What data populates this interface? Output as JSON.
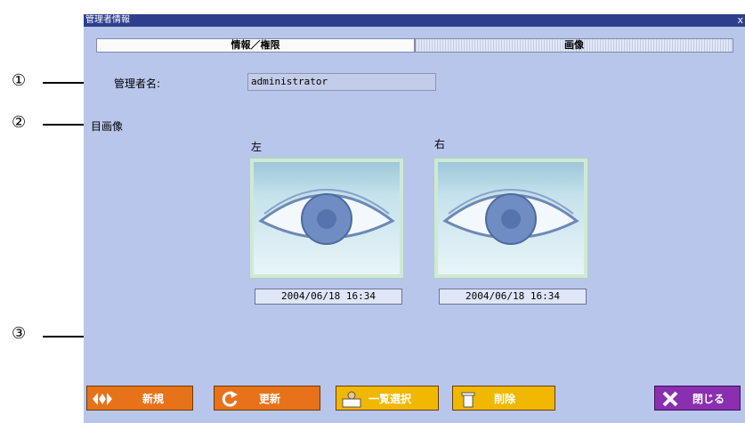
{
  "window": {
    "title": "管理者情報",
    "close_glyph": "x"
  },
  "tabs": [
    {
      "label": "情報／権限"
    },
    {
      "label": "画像"
    }
  ],
  "fields": {
    "admin_name_label": "管理者名:",
    "admin_name_value": "administrator",
    "eye_image_label": "目画像",
    "left_label": "左",
    "right_label": "右",
    "left_date": "2004/06/18 16:34",
    "right_date": "2004/06/18 16:34"
  },
  "callouts": {
    "c1": "①",
    "c2": "②",
    "c3": "③"
  },
  "buttons": {
    "new": "新規",
    "refresh": "更新",
    "list_select": "一覧選択",
    "delete": "削除",
    "close": "閉じる"
  },
  "icons": [
    "diamond-arrows-icon",
    "refresh-icon",
    "user-list-icon",
    "trash-icon",
    "close-x-icon"
  ],
  "colors": {
    "window_bg": "#b9c6ec",
    "titlebar": "#2d3f8c",
    "button_orange": "#e8721a",
    "button_yellow": "#f0b800",
    "button_purple": "#8a2fb0"
  }
}
